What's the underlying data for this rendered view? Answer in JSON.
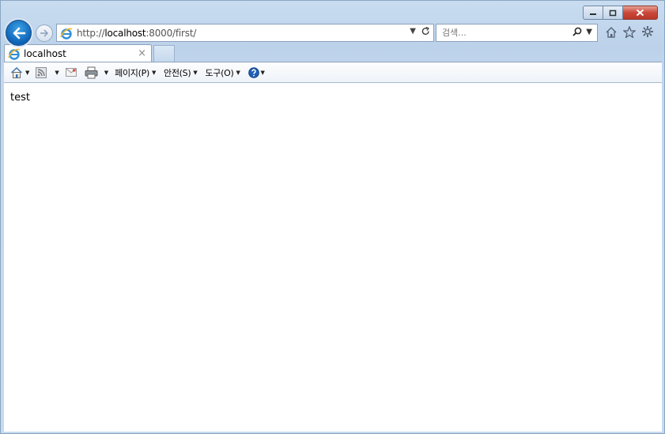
{
  "window": {
    "caption_buttons": [
      "minimize",
      "restore",
      "close"
    ]
  },
  "address": {
    "url_prefix": "http://",
    "url_host": "localhost",
    "url_rest": ":8000/first/"
  },
  "search": {
    "placeholder": "검색..."
  },
  "tab": {
    "label": "localhost",
    "close": "×"
  },
  "command_bar": {
    "page_menu": "페이지(P)",
    "safety_menu": "안전(S)",
    "tools_menu": "도구(O)"
  },
  "page": {
    "body_text": "test"
  },
  "colors": {
    "accent_back": "#0d62b5",
    "close_button": "#c9483a",
    "frame": "#c7daee"
  }
}
